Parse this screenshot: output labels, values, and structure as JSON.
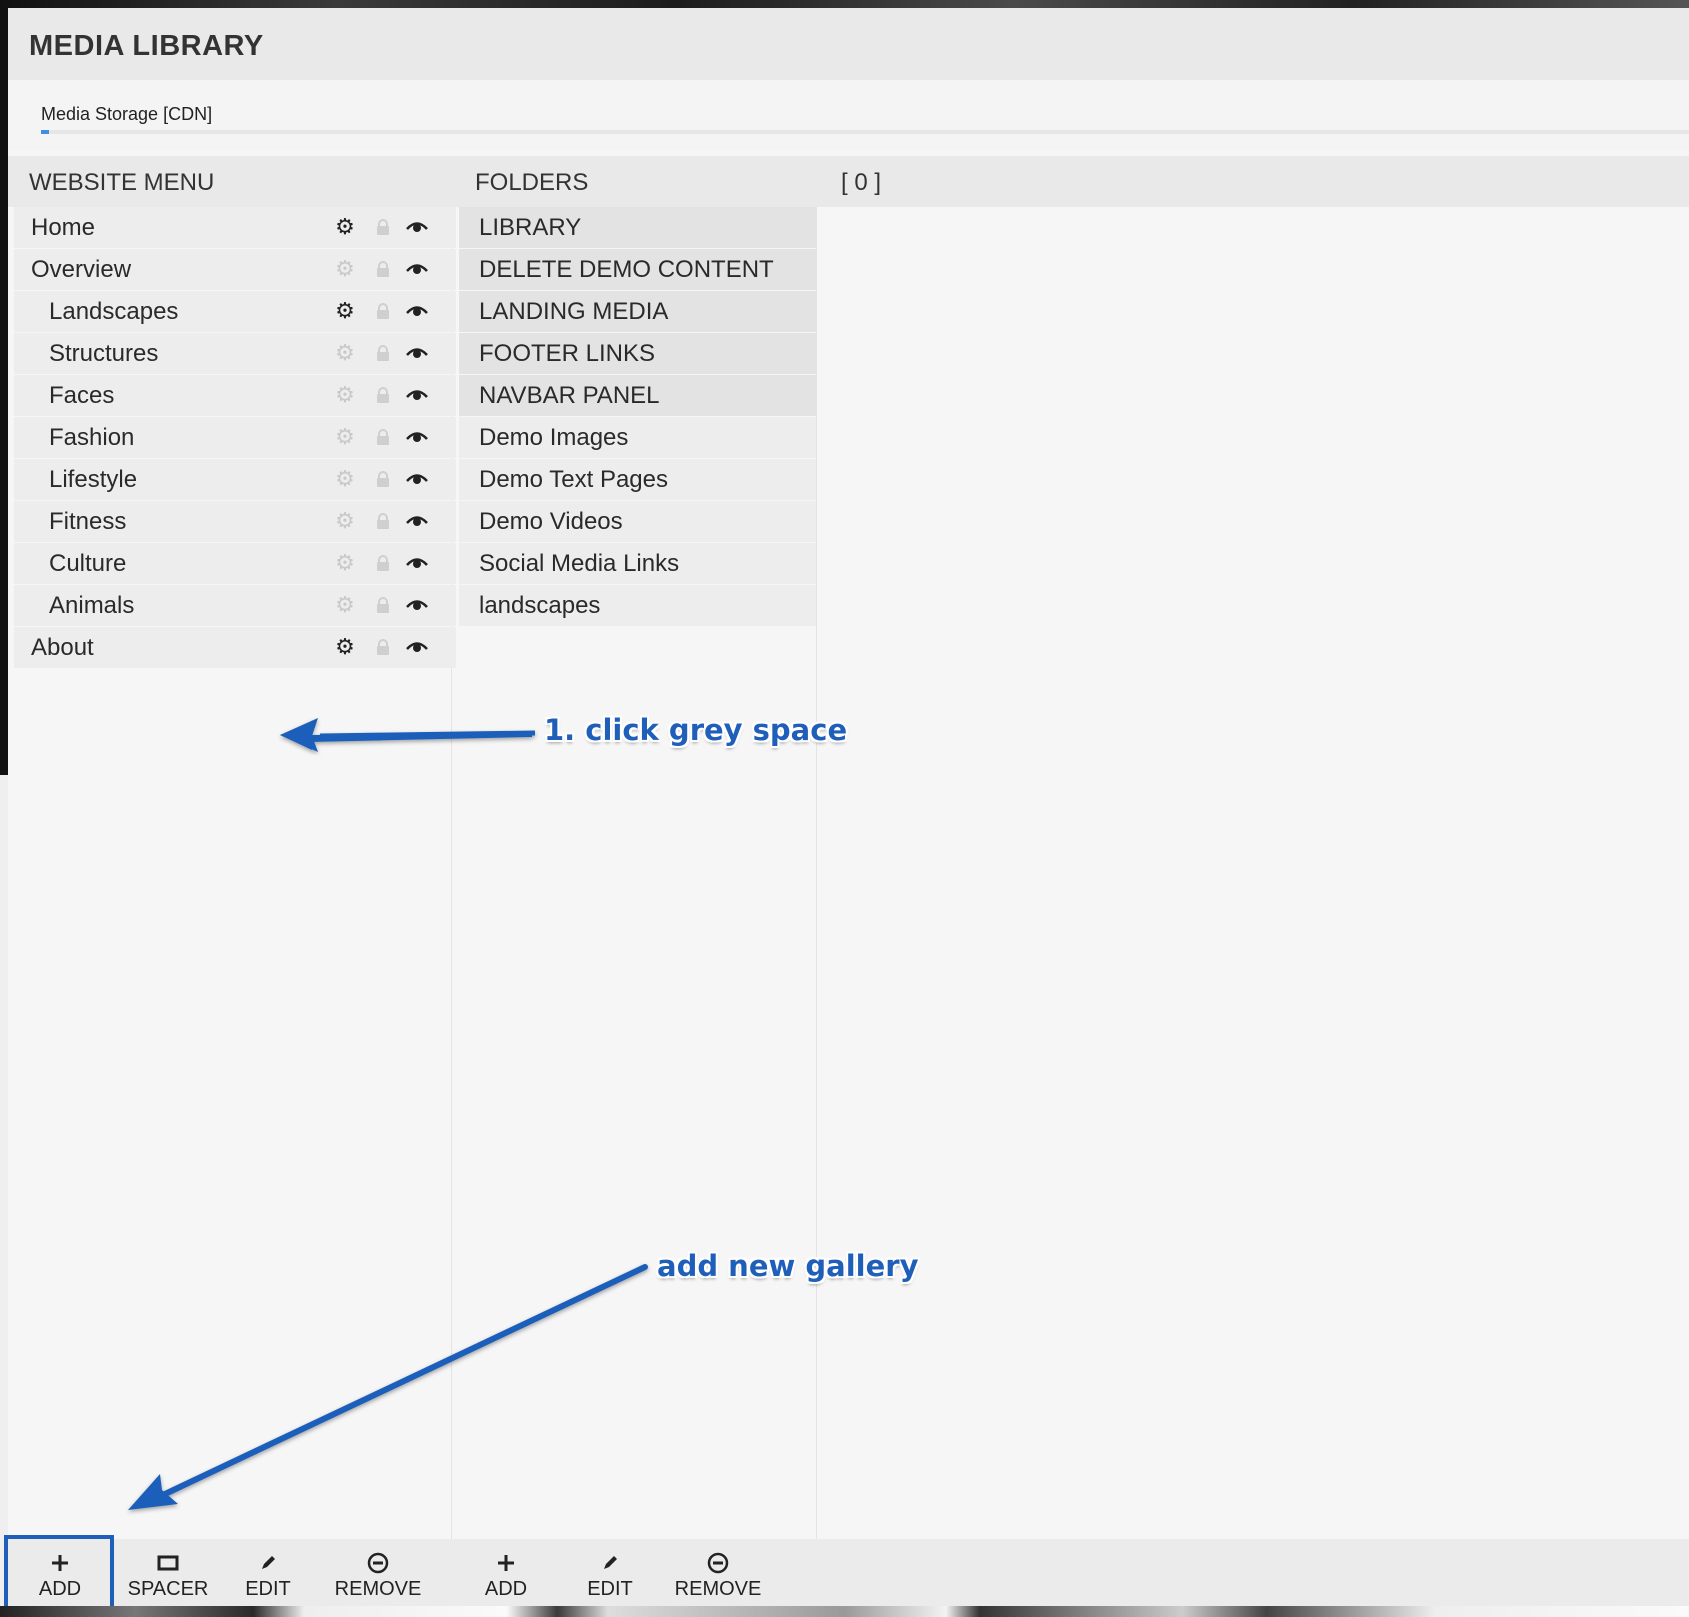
{
  "app": {
    "title": "MEDIA LIBRARY"
  },
  "tabs": {
    "active_label": "Media Storage [CDN]",
    "progress_percent": 0.5
  },
  "columns": {
    "menu_header": "WEBSITE MENU",
    "folders_header": "FOLDERS",
    "content_header": "[ 0 ]"
  },
  "menu_items": [
    {
      "label": "Home",
      "level": 0,
      "settings_active": true
    },
    {
      "label": "Overview",
      "level": 0,
      "settings_active": false
    },
    {
      "label": "Landscapes",
      "level": 1,
      "settings_active": true
    },
    {
      "label": "Structures",
      "level": 1,
      "settings_active": false
    },
    {
      "label": "Faces",
      "level": 1,
      "settings_active": false
    },
    {
      "label": "Fashion",
      "level": 1,
      "settings_active": false
    },
    {
      "label": "Lifestyle",
      "level": 1,
      "settings_active": false
    },
    {
      "label": "Fitness",
      "level": 1,
      "settings_active": false
    },
    {
      "label": "Culture",
      "level": 1,
      "settings_active": false
    },
    {
      "label": "Animals",
      "level": 1,
      "settings_active": false
    },
    {
      "label": "About",
      "level": 0,
      "settings_active": true
    }
  ],
  "folders": [
    {
      "label": "LIBRARY",
      "system": true
    },
    {
      "label": "DELETE DEMO CONTENT",
      "system": true
    },
    {
      "label": "LANDING MEDIA",
      "system": true
    },
    {
      "label": "FOOTER LINKS",
      "system": true
    },
    {
      "label": "NAVBAR PANEL",
      "system": true
    },
    {
      "label": "Demo Images",
      "system": false
    },
    {
      "label": "Demo Text Pages",
      "system": false
    },
    {
      "label": "Demo Videos",
      "system": false
    },
    {
      "label": "Social Media Links",
      "system": false
    },
    {
      "label": "landscapes",
      "system": false
    }
  ],
  "annotations": {
    "click_grey_space": "1. click grey space",
    "add_new_gallery": "add new gallery"
  },
  "menu_toolbar": {
    "add": "ADD",
    "spacer": "SPACER",
    "edit": "EDIT",
    "remove": "REMOVE"
  },
  "folder_toolbar": {
    "add": "ADD",
    "edit": "EDIT",
    "remove": "REMOVE"
  },
  "colors": {
    "accent": "#3c8ee6",
    "annotation": "#1f5fba",
    "gear_active": "#222222",
    "gear_inactive": "#c9c9c9"
  },
  "icons": {
    "menu_row": [
      "gear-icon",
      "lock-icon",
      "eye-icon"
    ],
    "toolbar": [
      "plus-icon",
      "spacer-icon",
      "pencil-icon",
      "minus-circle-icon"
    ]
  }
}
